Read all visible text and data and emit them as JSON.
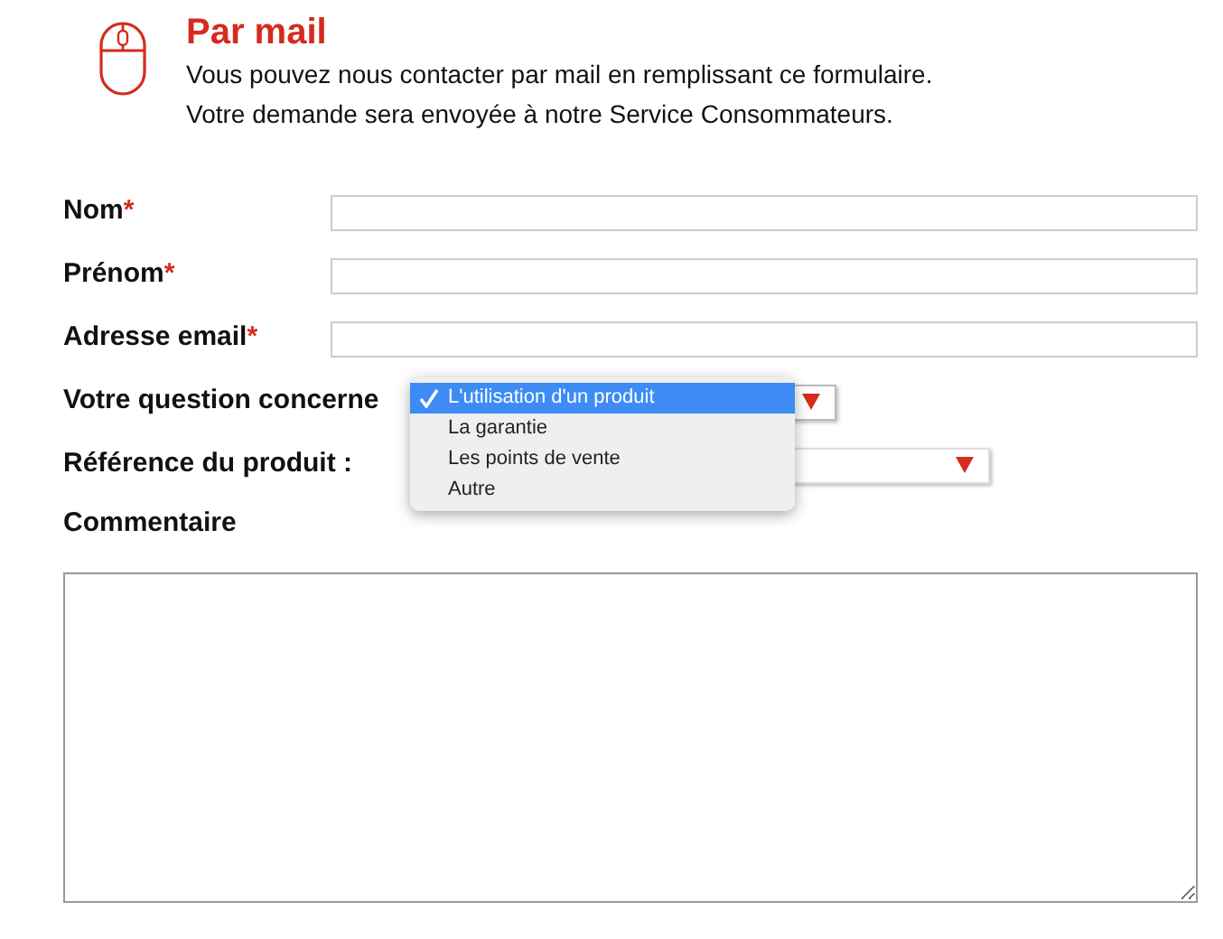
{
  "header": {
    "title": "Par mail",
    "lines": [
      "Vous pouvez nous contacter par mail en remplissant ce formulaire.",
      "Votre demande sera envoyée à notre Service Consommateurs."
    ]
  },
  "fields": [
    {
      "label": "Nom",
      "marker": "*",
      "kind": "text"
    },
    {
      "label": "Prénom",
      "marker": "*",
      "kind": "text"
    },
    {
      "label": "Adresse email",
      "marker": "*",
      "kind": "text"
    },
    {
      "label": "Votre question concerne",
      "kind": "select",
      "expanded": true,
      "options": [
        {
          "label": "L'utilisation d'un produit",
          "selected": true
        },
        {
          "label": "La garantie",
          "selected": false
        },
        {
          "label": "Les points de vente",
          "selected": false
        },
        {
          "label": "Autre",
          "selected": false
        }
      ]
    },
    {
      "label": "Référence du produit :",
      "kind": "select"
    },
    {
      "label": "Commentaire",
      "kind": "textarea"
    }
  ]
}
